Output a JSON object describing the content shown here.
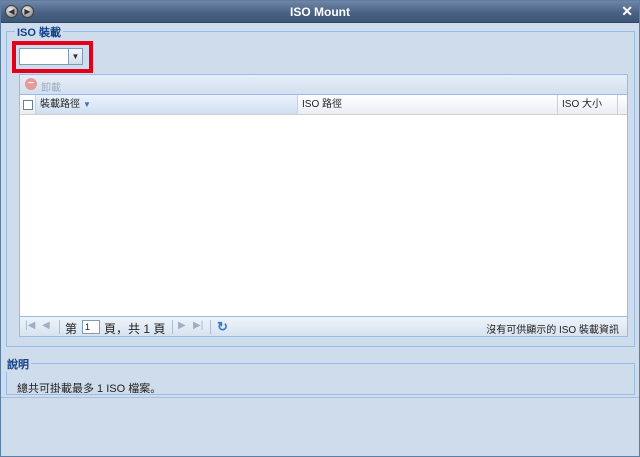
{
  "window": {
    "title": "ISO Mount"
  },
  "mount_section": {
    "legend": "ISO 裝載",
    "combo_value": ""
  },
  "toolbar": {
    "unmount_label": "卸載"
  },
  "grid": {
    "columns": [
      "裝載路徑",
      "ISO 路徑",
      "ISO 大小"
    ],
    "rows": []
  },
  "pager": {
    "page_prefix": "第",
    "current_page": "1",
    "page_suffix": "頁，共 1 頁",
    "info": "沒有可供顯示的 ISO 裝載資訊"
  },
  "description_section": {
    "legend": "說明",
    "text": "總共可掛載最多 1 ISO 檔案。"
  }
}
